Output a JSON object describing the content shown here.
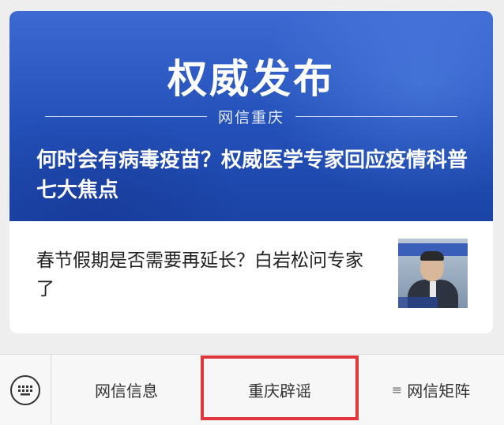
{
  "banner": {
    "title": "权威发布",
    "source": "网信重庆",
    "headline": "何时会有病毒疫苗？权威医学专家回应疫情科普七大焦点"
  },
  "article": {
    "title": "春节假期是否需要再延长？白岩松问专家了",
    "thumbnail_icon": "person-photo"
  },
  "tabbar": {
    "keyboard_icon": "keyboard-icon",
    "tabs": [
      {
        "label": "网信信息"
      },
      {
        "label": "重庆辟谣"
      },
      {
        "label": "网信矩阵",
        "icon": "menu-icon"
      }
    ],
    "highlight_color": "#e0363c"
  }
}
